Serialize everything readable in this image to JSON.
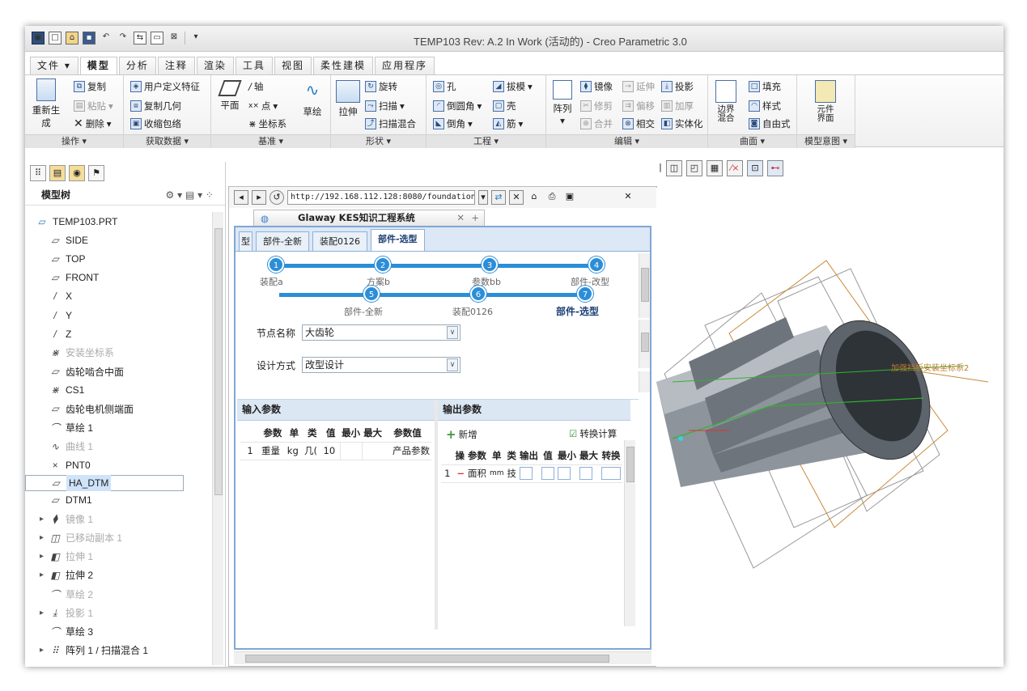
{
  "window": {
    "title": "TEMP103 Rev: A.2 In Work (活动的) - Creo Parametric 3.0"
  },
  "ribbon_tabs": [
    "文件",
    "模型",
    "分析",
    "注释",
    "渲染",
    "工具",
    "视图",
    "柔性建模",
    "应用程序"
  ],
  "ribbon": {
    "ops": {
      "regen": "重新生成",
      "copy": "复制",
      "paste": "粘贴",
      "delete": "删除",
      "label": "操作"
    },
    "getdata": {
      "udf": "用户定义特征",
      "copygeom": "复制几何",
      "shrinkwrap": "收缩包络",
      "label": "获取数据"
    },
    "datum": {
      "plane": "平面",
      "axis": "轴",
      "point": "点",
      "csys": "坐标系",
      "sketch": "草绘",
      "label": "基准"
    },
    "shapes": {
      "extrude": "拉伸",
      "revolve": "旋转",
      "sweep": "扫描",
      "sweptblend": "扫描混合",
      "label": "形状"
    },
    "eng": {
      "hole": "孔",
      "draft": "拔模",
      "round": "倒圆角",
      "shell": "壳",
      "chamfer": "倒角",
      "rib": "筋",
      "label": "工程"
    },
    "edit": {
      "pattern": "阵列",
      "mirror": "镜像",
      "extend": "延伸",
      "project": "投影",
      "trim": "修剪",
      "offset": "偏移",
      "thicken": "加厚",
      "merge": "合并",
      "intersect": "相交",
      "solidify": "实体化",
      "label": "编辑"
    },
    "surf": {
      "boundary": "边界混合",
      "fill": "填充",
      "style": "样式",
      "freestyle": "自由式",
      "label": "曲面"
    },
    "intent": {
      "compiface": "元件界面",
      "label": "模型意图"
    }
  },
  "tree": {
    "title": "模型树",
    "items": [
      {
        "icon": "part-icon",
        "label": "TEMP103.PRT",
        "state": "normal"
      },
      {
        "icon": "plane-icon",
        "label": "SIDE",
        "state": "normal"
      },
      {
        "icon": "plane-icon",
        "label": "TOP",
        "state": "normal"
      },
      {
        "icon": "plane-icon",
        "label": "FRONT",
        "state": "normal"
      },
      {
        "icon": "axis-icon",
        "label": "X",
        "state": "normal"
      },
      {
        "icon": "axis-icon",
        "label": "Y",
        "state": "normal"
      },
      {
        "icon": "axis-icon",
        "label": "Z",
        "state": "normal"
      },
      {
        "icon": "csys-icon",
        "label": "安装坐标系",
        "state": "dim"
      },
      {
        "icon": "plane-icon",
        "label": "齿轮啮合中面",
        "state": "normal"
      },
      {
        "icon": "csys-icon",
        "label": "CS1",
        "state": "normal"
      },
      {
        "icon": "plane-icon",
        "label": "齿轮电机侧端面",
        "state": "normal"
      },
      {
        "icon": "sketch-icon",
        "label": "草绘 1",
        "state": "normal"
      },
      {
        "icon": "curve-icon",
        "label": "曲线 1",
        "state": "dim"
      },
      {
        "icon": "point-icon",
        "label": "PNT0",
        "state": "normal"
      },
      {
        "icon": "plane-icon",
        "label": "HA_DTM",
        "state": "selected"
      },
      {
        "icon": "plane-icon",
        "label": "DTM1",
        "state": "normal"
      },
      {
        "icon": "mirror-icon",
        "label": "镜像 1",
        "state": "dim",
        "expand": true
      },
      {
        "icon": "moved-copy-icon",
        "label": "已移动副本 1",
        "state": "dim",
        "expand": true
      },
      {
        "icon": "extrude-icon",
        "label": "拉伸 1",
        "state": "dim",
        "expand": true
      },
      {
        "icon": "extrude-icon",
        "label": "拉伸 2",
        "state": "normal",
        "expand": true
      },
      {
        "icon": "sketch-icon",
        "label": "草绘 2",
        "state": "dim"
      },
      {
        "icon": "project-icon",
        "label": "投影 1",
        "state": "dim",
        "expand": true
      },
      {
        "icon": "sketch-icon",
        "label": "草绘 3",
        "state": "normal"
      },
      {
        "icon": "pattern-icon",
        "label": "阵列 1 / 扫描混合 1",
        "state": "normal",
        "expand": true
      }
    ]
  },
  "browser": {
    "url": "http://192.168.112.128:8080/foundation/",
    "tab_title": "Glaway KES知识工程系统",
    "subtabs": [
      "型",
      "部件-全新",
      "装配0126",
      "部件-选型"
    ],
    "steps": [
      {
        "n": "1",
        "label": "装配a"
      },
      {
        "n": "2",
        "label": "方案b"
      },
      {
        "n": "3",
        "label": "参数bb"
      },
      {
        "n": "4",
        "label": "部件-改型"
      },
      {
        "n": "5",
        "label": "部件-全新"
      },
      {
        "n": "6",
        "label": "装配0126"
      },
      {
        "n": "7",
        "label": "部件-选型"
      }
    ],
    "form": {
      "node_label": "节点名称",
      "node_value": "大齿轮",
      "method_label": "设计方式",
      "method_value": "改型设计"
    },
    "input": {
      "title": "输入参数",
      "headers": [
        "参数",
        "单",
        "类",
        "值",
        "最小",
        "最大",
        "参数值"
      ],
      "rows": [
        [
          "1",
          "重量",
          "kg",
          "几(",
          "10",
          "",
          "",
          "产品参数"
        ]
      ]
    },
    "output": {
      "title": "输出参数",
      "add": "新增",
      "convert": "转换计算",
      "headers": [
        "操",
        "参数",
        "单",
        "类",
        "输出",
        "值",
        "最小",
        "最大",
        "转换"
      ],
      "rows": [
        [
          "1",
          "面积",
          "mm",
          "技"
        ]
      ]
    }
  },
  "model_label": "加强挡板安装坐标系2"
}
